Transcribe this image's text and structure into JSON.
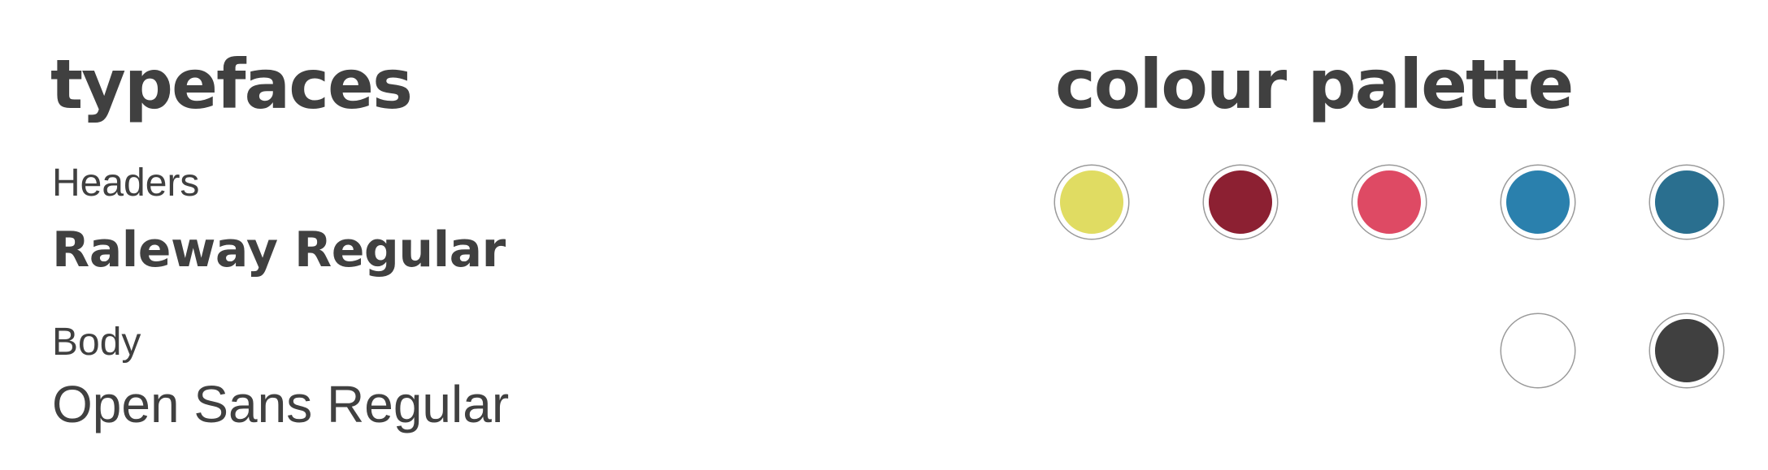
{
  "typefaces": {
    "heading": "typefaces",
    "headers_label": "Headers",
    "headers_font": "Raleway Regular",
    "body_label": "Body",
    "body_font": "Open Sans Regular"
  },
  "palette": {
    "heading": "colour palette",
    "swatches": [
      {
        "color": "#e0dc62"
      },
      {
        "color": "#8c2032"
      },
      {
        "color": "#de4a64"
      },
      {
        "color": "#2a80ad"
      },
      {
        "color": "#2a6f8f"
      },
      {
        "color": "#ffffff"
      },
      {
        "color": "#404040"
      }
    ]
  }
}
